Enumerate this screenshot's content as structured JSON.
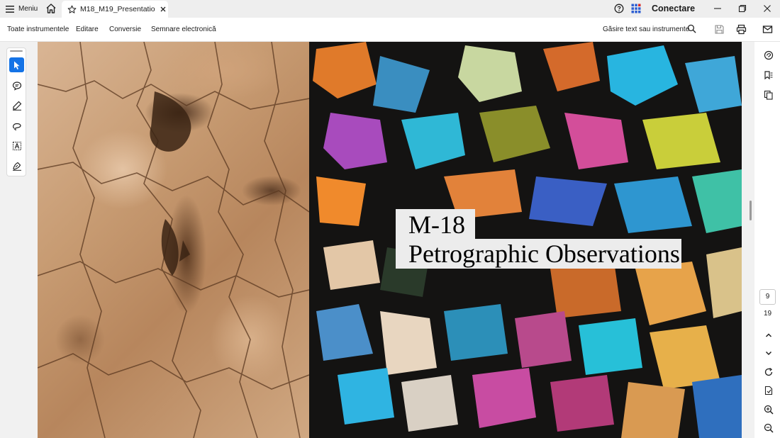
{
  "titlebar": {
    "menu_label": "Meniu",
    "tab_title": "M18_M19_Presentatio...",
    "signin_label": "Conectare"
  },
  "toolbar": {
    "items": [
      "Toate instrumentele",
      "Editare",
      "Conversie",
      "Semnare electronică"
    ],
    "find_label": "Găsire text sau instrumente"
  },
  "slide": {
    "title_line1": "M-18",
    "title_line2": "Petrographic Observations"
  },
  "navigation": {
    "current_page": "9",
    "total_pages": "19"
  },
  "icons": {
    "left_tools": [
      "select-icon",
      "comment-icon",
      "highlight-pen-icon",
      "lasso-draw-icon",
      "text-box-icon",
      "sign-icon"
    ],
    "right_rail": [
      "ai-assistant-icon",
      "bookmarks-icon",
      "pages-copy-icon",
      "chevron-up-icon",
      "chevron-down-icon",
      "refresh-icon",
      "document-settings-icon",
      "zoom-in-icon",
      "zoom-out-icon"
    ]
  },
  "colors": {
    "accent": "#1473e6",
    "titlebar_bg": "#eeeeee"
  }
}
